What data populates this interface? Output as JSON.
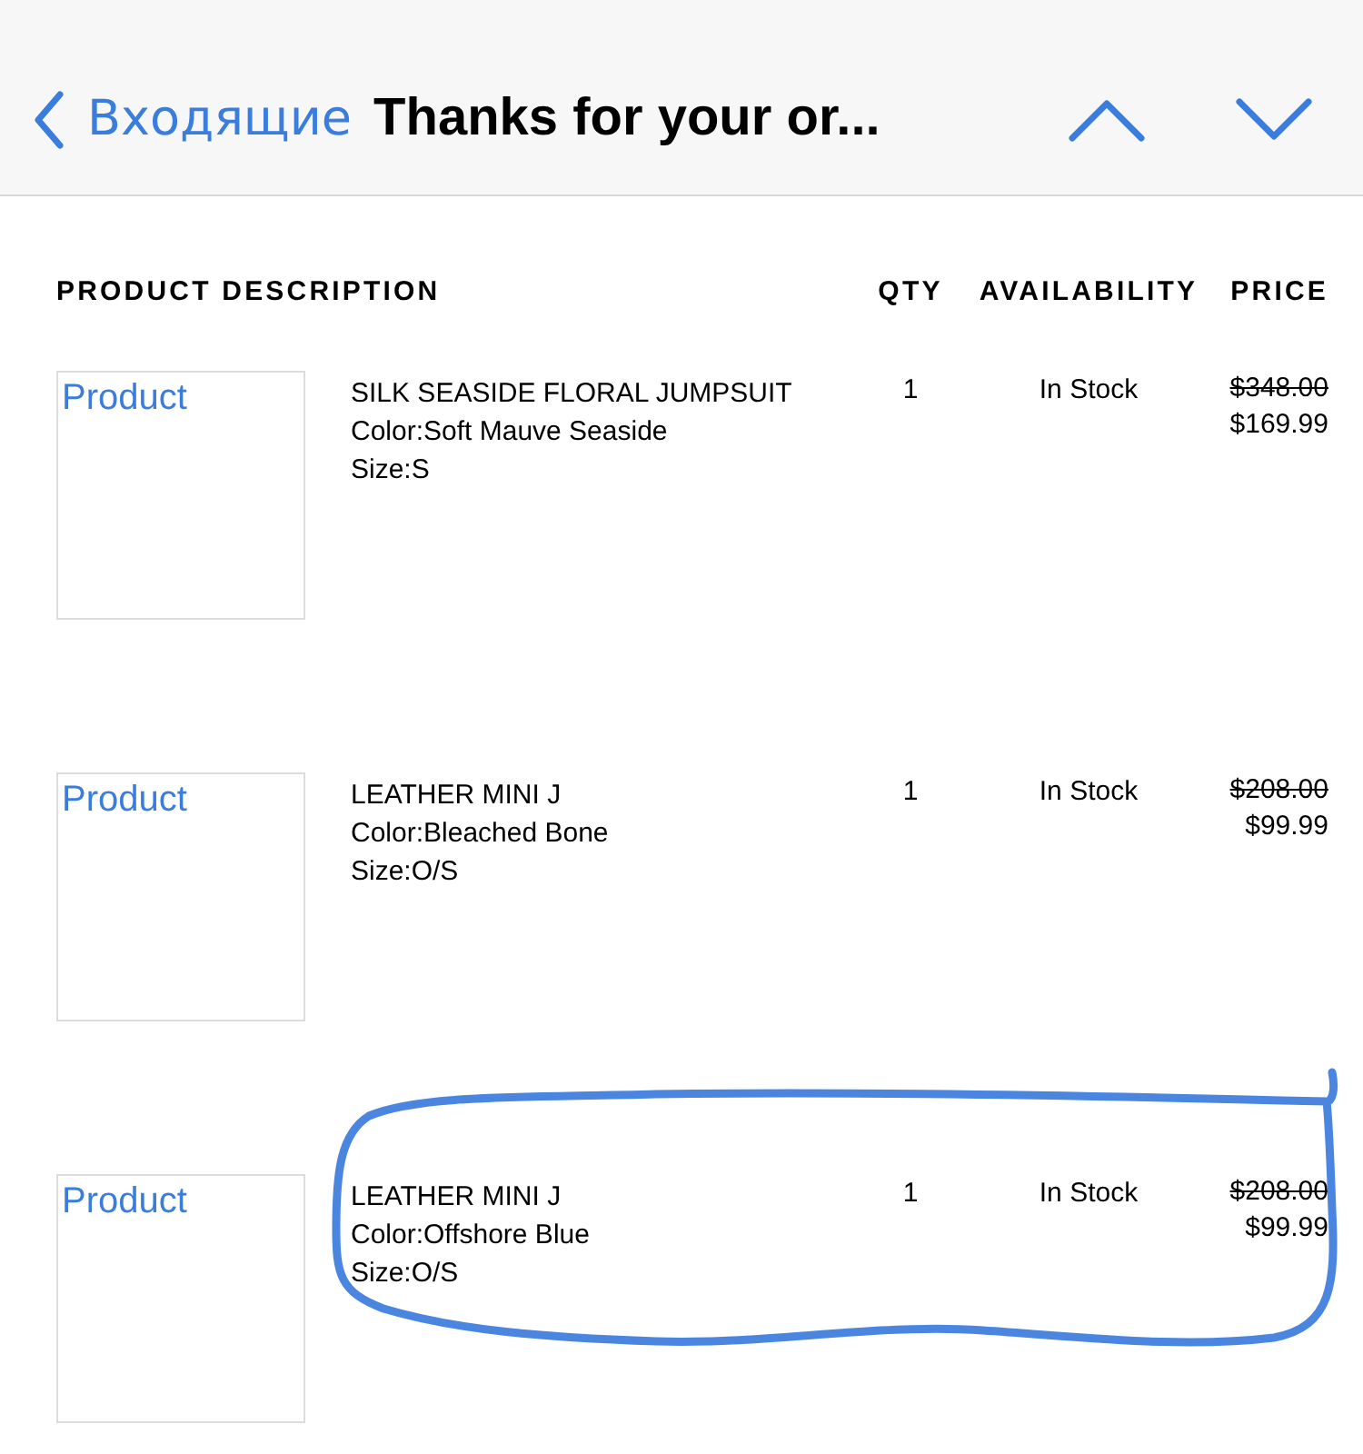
{
  "nav_bar": {
    "back_label": "Входящие",
    "title": "Thanks for your or..."
  },
  "table": {
    "columns": [
      "PRODUCT DESCRIPTION",
      "QTY",
      "AVAILABILITY",
      "PRICE"
    ],
    "rows": [
      {
        "image_alt": "Product",
        "name": "SILK SEASIDE FLORAL JUMPSUIT",
        "color_label": "Color:Soft Mauve Seaside",
        "size": "Size:S",
        "qty": "1",
        "availability": "In Stock",
        "old_price": "$348.00",
        "price": "$169.99",
        "highlighted": false
      },
      {
        "image_alt": "Product",
        "name": "LEATHER MINI J",
        "color_label": "Color:Bleached Bone",
        "size": "Size:O/S",
        "qty": "1",
        "availability": "In Stock",
        "old_price": "$208.00",
        "price": "$99.99",
        "highlighted": false
      },
      {
        "image_alt": "Product",
        "name": "LEATHER MINI J",
        "color_label": "Color:Offshore Blue",
        "size": "Size:O/S",
        "qty": "1",
        "availability": "In Stock",
        "old_price": "$208.00",
        "price": "$99.99",
        "highlighted": true
      }
    ]
  }
}
